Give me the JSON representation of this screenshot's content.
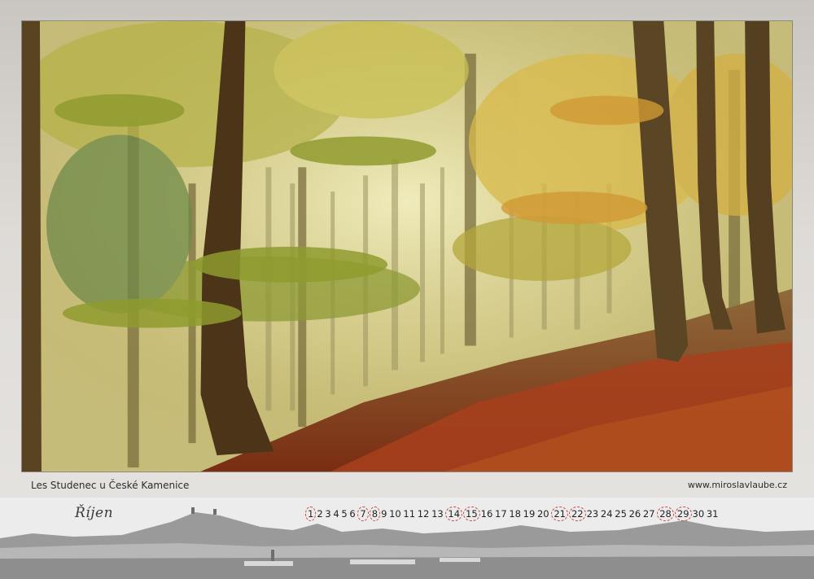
{
  "photo": {
    "caption": "Les Studenec u České Kamenice",
    "website": "www.miroslavlaube.cz"
  },
  "calendar": {
    "month": "Říjen",
    "days": [
      {
        "n": "1",
        "marked": true
      },
      {
        "n": "2",
        "marked": false
      },
      {
        "n": "3",
        "marked": false
      },
      {
        "n": "4",
        "marked": false
      },
      {
        "n": "5",
        "marked": false
      },
      {
        "n": "6",
        "marked": false
      },
      {
        "n": "7",
        "marked": true
      },
      {
        "n": "8",
        "marked": true
      },
      {
        "n": "9",
        "marked": false
      },
      {
        "n": "10",
        "marked": false
      },
      {
        "n": "11",
        "marked": false
      },
      {
        "n": "12",
        "marked": false
      },
      {
        "n": "13",
        "marked": false
      },
      {
        "n": "14",
        "marked": true
      },
      {
        "n": "15",
        "marked": true
      },
      {
        "n": "16",
        "marked": false
      },
      {
        "n": "17",
        "marked": false
      },
      {
        "n": "18",
        "marked": false
      },
      {
        "n": "19",
        "marked": false
      },
      {
        "n": "20",
        "marked": false
      },
      {
        "n": "21",
        "marked": true
      },
      {
        "n": "22",
        "marked": true
      },
      {
        "n": "23",
        "marked": false
      },
      {
        "n": "24",
        "marked": false
      },
      {
        "n": "25",
        "marked": false
      },
      {
        "n": "26",
        "marked": false
      },
      {
        "n": "27",
        "marked": false
      },
      {
        "n": "28",
        "marked": true
      },
      {
        "n": "29",
        "marked": true
      },
      {
        "n": "30",
        "marked": false
      },
      {
        "n": "31",
        "marked": false
      }
    ]
  },
  "colors": {
    "marker": "#c44a44",
    "foliage": "#c9b045",
    "leaf_litter": "#a8401c"
  }
}
